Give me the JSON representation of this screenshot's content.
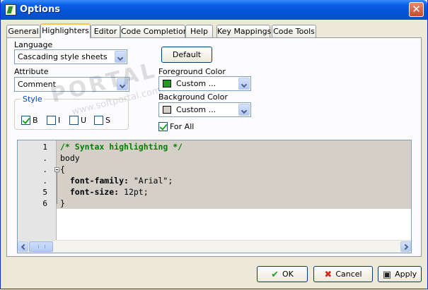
{
  "window": {
    "title": "Options",
    "close_symbol": "✕",
    "icon": "app-icon"
  },
  "tabs": [
    {
      "label": "General"
    },
    {
      "label": "Highlighters",
      "active": true
    },
    {
      "label": "Editor"
    },
    {
      "label": "Code Completion"
    },
    {
      "label": "Help"
    },
    {
      "label": "Key Mappings"
    },
    {
      "label": "Code Tools"
    }
  ],
  "language": {
    "label": "Language",
    "value": "Cascading style sheets"
  },
  "default_button": "Default",
  "attribute": {
    "label": "Attribute",
    "value": "Comment"
  },
  "style": {
    "label": "Style",
    "options": [
      {
        "label": "B",
        "checked": true
      },
      {
        "label": "I",
        "checked": false
      },
      {
        "label": "U",
        "checked": false
      },
      {
        "label": "S",
        "checked": false
      }
    ]
  },
  "foreground": {
    "label": "Foreground Color",
    "value": "Custom ...",
    "color": "#1f9d1f"
  },
  "background": {
    "label": "Background Color",
    "value": "Custom ...",
    "color": "#d4d0c8"
  },
  "for_all": {
    "label": "For All",
    "checked": true
  },
  "editor": {
    "gutter": [
      "1",
      ".",
      ".",
      ".",
      "5",
      "6"
    ],
    "lines": [
      {
        "text": "/* Syntax highlighting */",
        "kind": "comment"
      },
      {
        "text": "body",
        "kind": "plain"
      },
      {
        "text": "{",
        "kind": "plain"
      },
      {
        "text": "  font-family: \"Arial\";",
        "kind": "mixed",
        "prop": "  font-family:",
        "rest": " \"Arial\";"
      },
      {
        "text": "  font-size: 12pt;",
        "kind": "mixed",
        "prop": "  font-size:",
        "rest": " 12pt;"
      },
      {
        "text": "}",
        "kind": "plain"
      }
    ]
  },
  "footer": {
    "ok": "OK",
    "cancel": "Cancel",
    "apply": "Apply"
  },
  "watermark": {
    "main": "PORTAL",
    "sub": "www.softportal.com",
    "mark": "™"
  }
}
